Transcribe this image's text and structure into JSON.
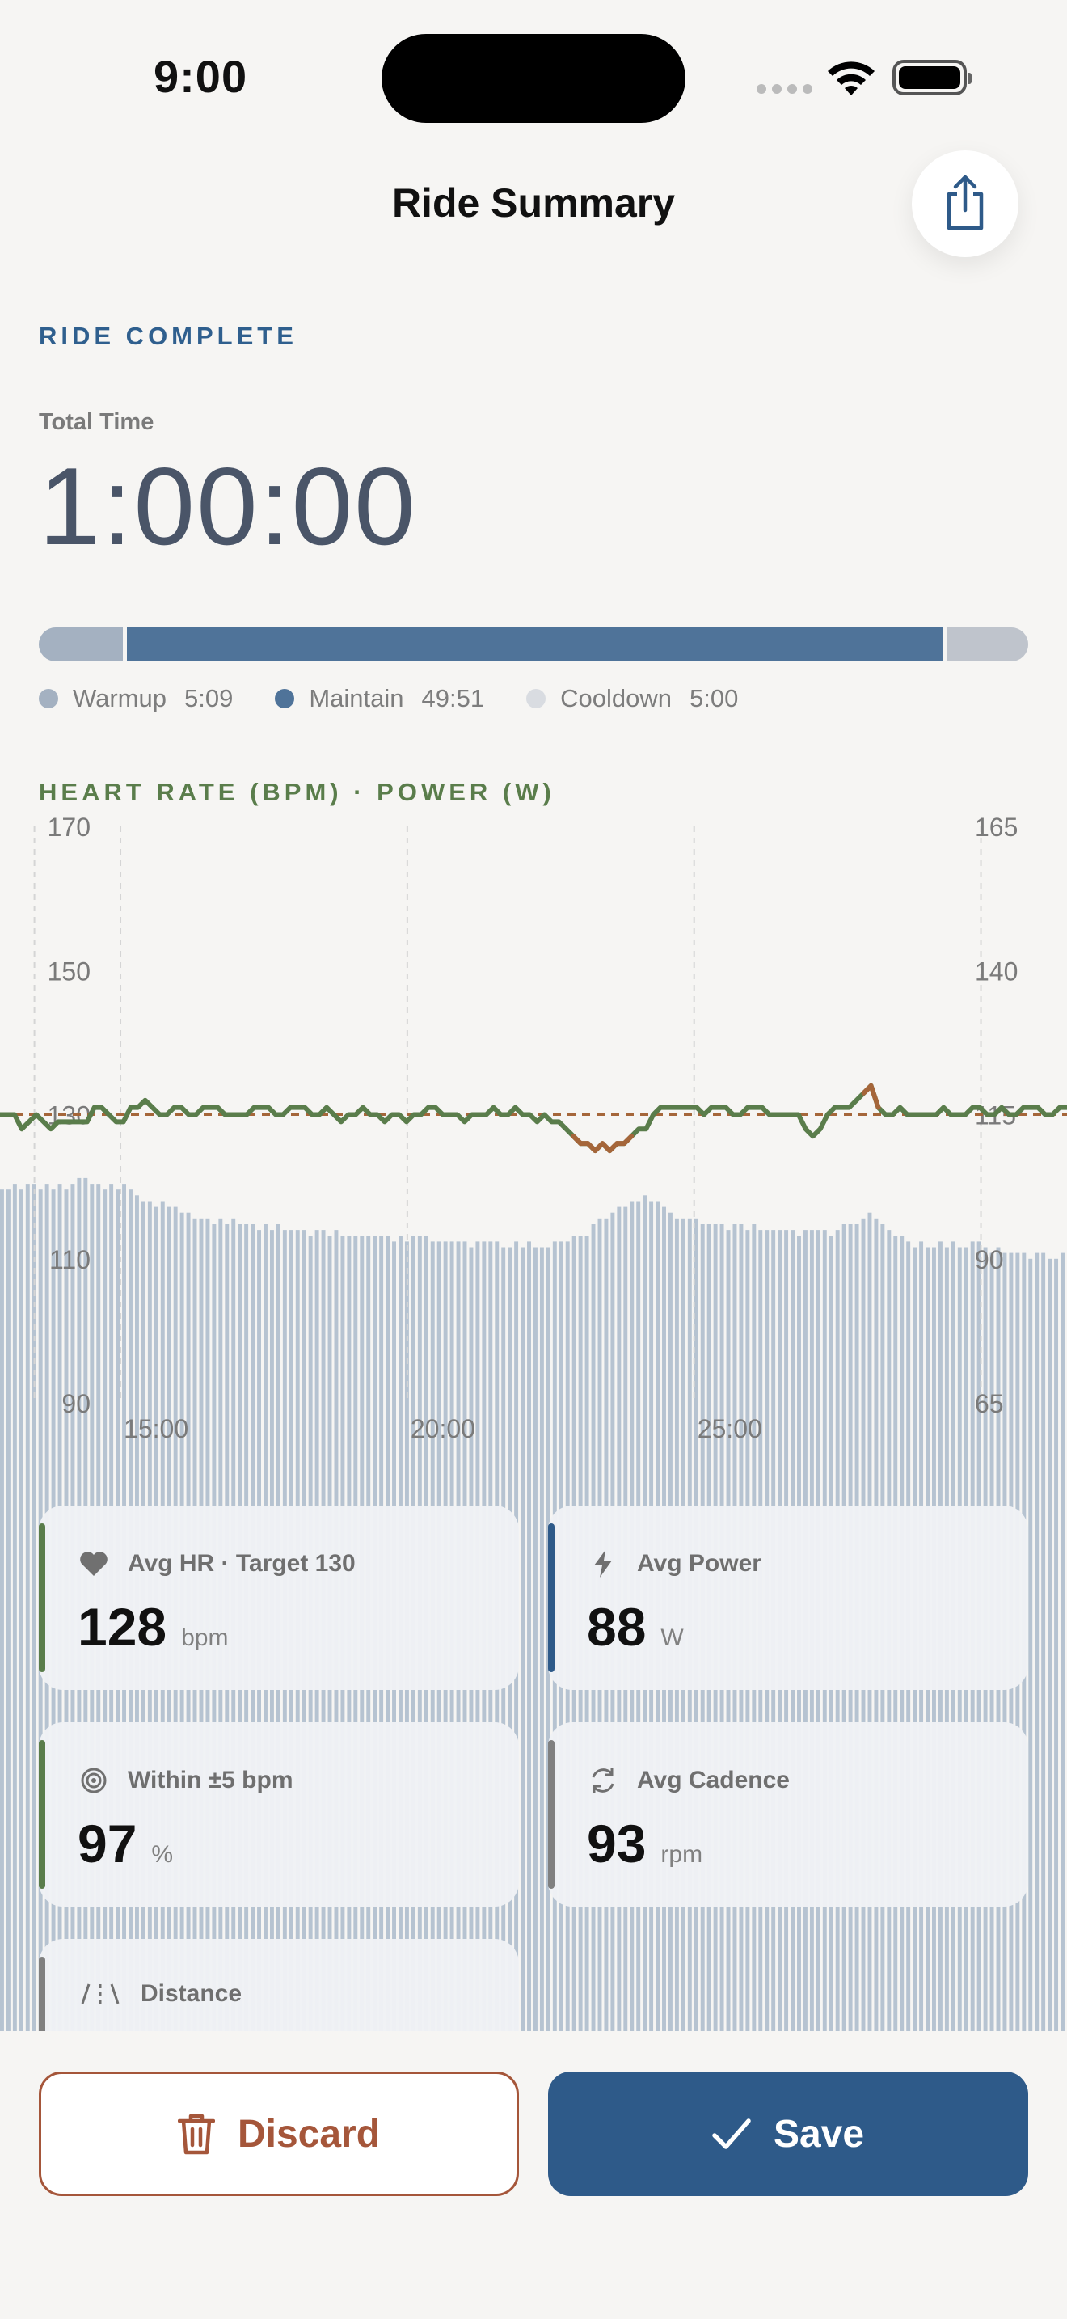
{
  "status_bar": {
    "time": "9:00"
  },
  "nav": {
    "title": "Ride Summary",
    "share_icon": "share-icon"
  },
  "summary": {
    "status_label": "RIDE COMPLETE",
    "total_time_label": "Total Time",
    "total_time": "1:00:00"
  },
  "phases": [
    {
      "name": "Warmup",
      "duration": "5:09",
      "fraction": 0.086,
      "color": "#a4b1c1"
    },
    {
      "name": "Maintain",
      "duration": "49:51",
      "fraction": 0.831,
      "color": "#4f7399"
    },
    {
      "name": "Cooldown",
      "duration": "5:00",
      "fraction": 0.083,
      "color": "#d9dce1"
    }
  ],
  "chart_title": "HEART RATE (BPM) · POWER (W)",
  "chart_data": {
    "type": "line",
    "x_unit": "minutes",
    "x_range": [
      12.9,
      31.5
    ],
    "x_ticks": [
      15,
      20,
      25
    ],
    "x_tick_labels": [
      "15:00",
      "20:00",
      "25:00"
    ],
    "y_left_ticks": [
      "170",
      "150",
      "130",
      "110",
      "90"
    ],
    "y_left_range": [
      90,
      170
    ],
    "y_right_ticks": [
      "165",
      "140",
      "115",
      "90",
      "65"
    ],
    "y_right_range": [
      65,
      165
    ],
    "target_hr": 130,
    "grid": "vertical dashed",
    "series": [
      {
        "axis": "left",
        "type": "line",
        "color": "#5a7d4b",
        "high_color": "#a5663a",
        "values": [
          130,
          130,
          130,
          128,
          129,
          130,
          129,
          128,
          129,
          129,
          129,
          129,
          129,
          131,
          131,
          130,
          129,
          129,
          131,
          131,
          132,
          131,
          130,
          130,
          131,
          131,
          130,
          130,
          131,
          131,
          131,
          130,
          130,
          130,
          130,
          131,
          131,
          131,
          130,
          130,
          131,
          131,
          131,
          130,
          130,
          131,
          130,
          129,
          130,
          130,
          131,
          130,
          130,
          129,
          130,
          130,
          129,
          130,
          130,
          131,
          131,
          130,
          130,
          130,
          129,
          130,
          130,
          130,
          131,
          130,
          130,
          131,
          130,
          130,
          129,
          130,
          129,
          129,
          128,
          127,
          126,
          126,
          125,
          126,
          125,
          126,
          126,
          127,
          128,
          128,
          130,
          131,
          131,
          131,
          131,
          131,
          131,
          130,
          131,
          131,
          131,
          130,
          130,
          131,
          131,
          131,
          130,
          130,
          130,
          130,
          130,
          128,
          127,
          128,
          130,
          131,
          131,
          131,
          132,
          133,
          134,
          131,
          130,
          130,
          131,
          130,
          130,
          130,
          130,
          130,
          131,
          130,
          130,
          130,
          131,
          131,
          130,
          130,
          131,
          130,
          130,
          131,
          131,
          131,
          130,
          130,
          131,
          131
        ]
      },
      {
        "axis": "right",
        "type": "bar",
        "color": "#b6c3d1",
        "values": [
          102,
          102,
          103,
          102,
          103,
          103,
          102,
          103,
          102,
          103,
          102,
          103,
          104,
          104,
          103,
          103,
          102,
          103,
          102,
          103,
          102,
          101,
          100,
          100,
          99,
          100,
          99,
          99,
          98,
          98,
          97,
          97,
          97,
          96,
          97,
          96,
          97,
          96,
          96,
          96,
          95,
          96,
          95,
          96,
          95,
          95,
          95,
          95,
          94,
          95,
          95,
          94,
          95,
          94,
          94,
          94,
          94,
          94,
          94,
          94,
          94,
          93,
          94,
          93,
          94,
          94,
          94,
          93,
          93,
          93,
          93,
          93,
          93,
          92,
          93,
          93,
          93,
          93,
          92,
          92,
          93,
          92,
          93,
          92,
          92,
          92,
          93,
          93,
          93,
          94,
          94,
          94,
          96,
          97,
          97,
          98,
          99,
          99,
          100,
          100,
          101,
          100,
          100,
          99,
          98,
          97,
          97,
          97,
          97,
          96,
          96,
          96,
          96,
          95,
          96,
          96,
          95,
          96,
          95,
          95,
          95,
          95,
          95,
          95,
          94,
          95,
          95,
          95,
          95,
          94,
          95,
          96,
          96,
          96,
          97,
          98,
          97,
          96,
          95,
          94,
          94,
          93,
          92,
          93,
          92,
          92,
          93,
          92,
          93,
          92,
          92,
          93,
          93,
          92,
          91,
          92,
          91,
          91,
          91,
          91,
          90,
          91,
          91,
          90,
          90,
          91
        ]
      }
    ]
  },
  "stats": [
    {
      "label": "Avg HR · Target 130",
      "value": "128",
      "unit": "bpm",
      "icon": "heart-icon",
      "accent": "#5a7d4b"
    },
    {
      "label": "Avg Power",
      "value": "88",
      "unit": "W",
      "icon": "bolt-icon",
      "accent": "#2e5a89"
    },
    {
      "label": "Within ±5 bpm",
      "value": "97",
      "unit": "%",
      "icon": "target-icon",
      "accent": "#5a7d4b"
    },
    {
      "label": "Avg Cadence",
      "value": "93",
      "unit": "rpm",
      "icon": "cycle-icon",
      "accent": "#808080"
    },
    {
      "label": "Distance",
      "value": "",
      "unit": "",
      "icon": "road-icon",
      "accent": "#808080"
    }
  ],
  "actions": {
    "discard_label": "Discard",
    "save_label": "Save"
  }
}
